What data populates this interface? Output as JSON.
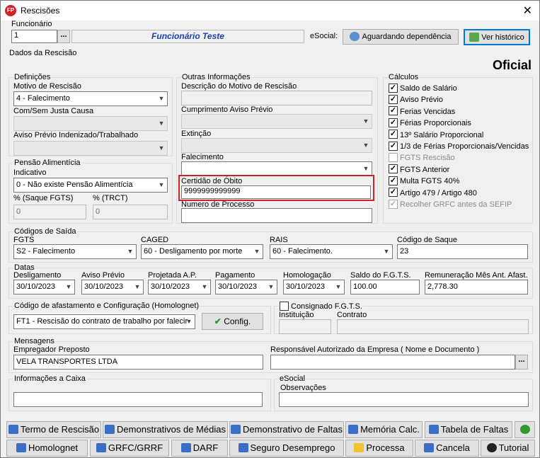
{
  "window": {
    "title": "Rescisões",
    "close": "✕"
  },
  "funcionario": {
    "label": "Funcionário",
    "code": "1",
    "name": "Funcionário Teste",
    "esocial_label": "eSocial:",
    "status_button": "Aguardando dependência",
    "history_button": "Ver histórico"
  },
  "section_title": "Dados da Rescisão",
  "badge": "Oficial",
  "definicoes": {
    "title": "Definições",
    "motivo_label": "Motivo de Rescisão",
    "motivo_value": "4 - Falecimento",
    "justa_label": "Com/Sem Justa Causa",
    "aviso_label": "Aviso Prévio Indenizado/Trabalhado"
  },
  "pensao": {
    "title": "Pensão Alimentícia",
    "indicativo_label": "Indicativo",
    "indicativo_value": "0 - Não existe Pensão Alimentícia",
    "saque_label": "% (Saque FGTS)",
    "saque_value": "0",
    "trct_label": "% (TRCT)",
    "trct_value": "0"
  },
  "outras": {
    "title": "Outras Informações",
    "descricao_label": "Descrição do Motivo de Rescisão",
    "cumprimento_label": "Cumprimento Aviso Prévio",
    "extincao_label": "Extinção",
    "falecimento_label": "Falecimento",
    "certidao_label": "Certidão de Óbito",
    "certidao_value": "9999999999999",
    "processo_label": "Numero de Processo"
  },
  "calculos": {
    "title": "Cálculos",
    "items": [
      {
        "label": "Saldo de Salário",
        "checked": true,
        "enabled": true
      },
      {
        "label": "Aviso Prévio",
        "checked": true,
        "enabled": true
      },
      {
        "label": "Ferias Vencidas",
        "checked": true,
        "enabled": true
      },
      {
        "label": "Férias Proporcionais",
        "checked": true,
        "enabled": true
      },
      {
        "label": "13º Salário Proporcional",
        "checked": true,
        "enabled": true
      },
      {
        "label": "1/3 de Férias Proporcionais/Vencidas",
        "checked": true,
        "enabled": true
      },
      {
        "label": "FGTS Rescisão",
        "checked": false,
        "enabled": false
      },
      {
        "label": "FGTS Anterior",
        "checked": true,
        "enabled": true
      },
      {
        "label": "Multa FGTS 40%",
        "checked": true,
        "enabled": true
      },
      {
        "label": "Artigo 479 / Artigo 480",
        "checked": true,
        "enabled": true
      },
      {
        "label": "Recolher GRFC antes da SEFIP",
        "checked": true,
        "enabled": false
      }
    ]
  },
  "codigos": {
    "title": "Códigos de Saída",
    "fgts_label": "FGTS",
    "fgts_value": "S2 - Falecimento",
    "caged_label": "CAGED",
    "caged_value": "60  -  Desligamento por morte",
    "rais_label": "RAIS",
    "rais_value": "60 - Falecimento.",
    "saque_label": "Código de Saque",
    "saque_value": "23"
  },
  "datas": {
    "title": "Datas",
    "deslig_label": "Desligamento",
    "deslig_value": "30/10/2023",
    "aviso_label": "Aviso Prévio",
    "aviso_value": "30/10/2023",
    "projetada_label": "Projetada A.P.",
    "projetada_value": "30/10/2023",
    "pagamento_label": "Pagamento",
    "pagamento_value": "30/10/2023",
    "homolog_label": "Homologação",
    "homolog_value": "30/10/2023",
    "saldo_label": "Saldo do F.G.T.S.",
    "saldo_value": "100.00",
    "remun_label": "Remuneração Mês Ant. Afast.",
    "remun_value": "2,778.30"
  },
  "afastamento": {
    "title": "Código de afastamento e Configuração (Homolognet)",
    "value": "FT1 - Rescisão do contrato de trabalho por falecir",
    "config_button": "Config."
  },
  "consignado": {
    "label": "Consignado F.G.T.S.",
    "instituicao_label": "Instituição",
    "contrato_label": "Contrato"
  },
  "mensagens": {
    "title": "Mensagens",
    "preposto_label": "Empregador Preposto",
    "preposto_value": "VELA TRANSPORTES LTDA",
    "responsavel_label": "Responsável Autorizado da Empresa ( Nome e Documento )"
  },
  "caixa": {
    "title": "Informações a Caixa"
  },
  "esocial": {
    "title": "eSocial",
    "obs_label": "Observações"
  },
  "buttons_row1": [
    "Termo de Rescisão",
    "Demonstrativos de Médias",
    "Demonstrativo de Faltas",
    "Memória Calc.",
    "Tabela de Faltas"
  ],
  "buttons_row2": [
    "Homolognet",
    "GRFC/GRRF",
    "DARF",
    "Seguro Desemprego",
    "Processa",
    "Cancela",
    "Tutorial"
  ],
  "colors": {
    "accent": "#1a3fb0",
    "highlight": "#d0202a"
  }
}
